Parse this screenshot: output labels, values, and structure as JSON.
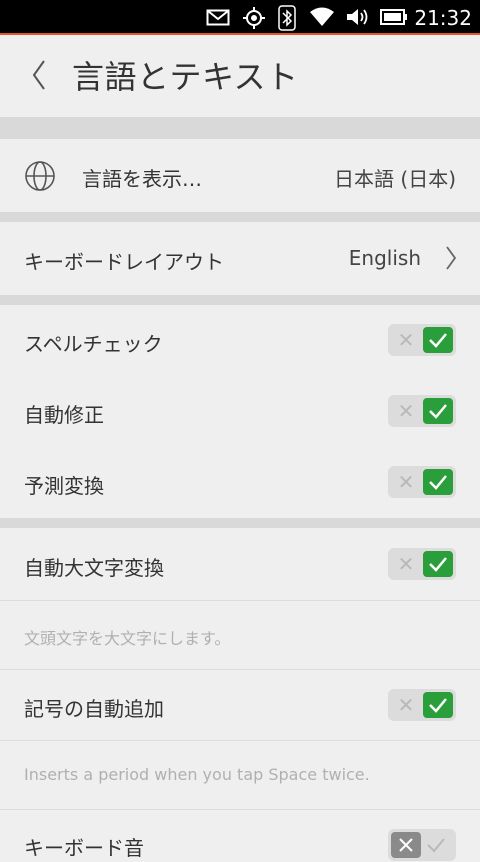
{
  "status_bar": {
    "time": "21:32",
    "icons": [
      "mail-icon",
      "location-icon",
      "bluetooth-icon",
      "wifi-icon",
      "volume-icon",
      "battery-icon"
    ]
  },
  "header": {
    "title": "言語とテキスト"
  },
  "rows": {
    "language": {
      "label": "言語を表示…",
      "value": "日本語 (日本)"
    },
    "keyboard_layout": {
      "label": "キーボードレイアウト",
      "value": "English"
    },
    "spell_check": {
      "label": "スペルチェック",
      "enabled": true
    },
    "auto_correct": {
      "label": "自動修正",
      "enabled": true
    },
    "predictive": {
      "label": "予測変換",
      "enabled": true
    },
    "auto_capitalize": {
      "label": "自動大文字変換",
      "enabled": true,
      "description": "文頭文字を大文字にします。"
    },
    "auto_punctuation": {
      "label": "記号の自動追加",
      "enabled": true,
      "description": "Inserts a period when you tap Space twice."
    },
    "keyboard_sound": {
      "label": "キーボード音",
      "enabled": false
    }
  },
  "colors": {
    "accent": "#e95420",
    "toggle_on": "#2a9e3a",
    "background": "#efefef"
  }
}
